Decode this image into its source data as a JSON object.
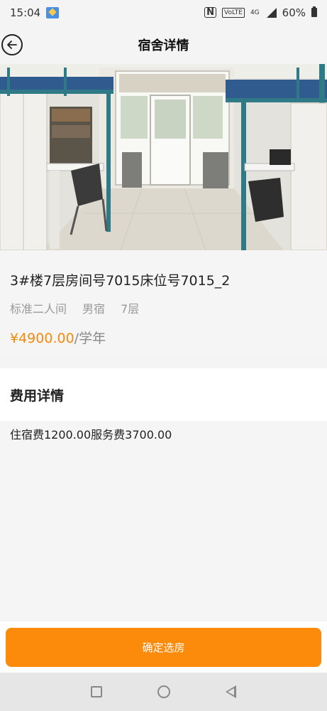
{
  "status_bar": {
    "time": "15:04",
    "nfc": "N",
    "volte": "VoLTE",
    "network": "4G",
    "battery": "60%"
  },
  "header": {
    "title": "宿舍详情",
    "back_icon": "back-arrow-circle-icon"
  },
  "room": {
    "title": "3#楼7层房间号7015床位号7015_2",
    "tags": [
      "标准二人间",
      "男宿",
      "7层"
    ],
    "price": "¥4900.00",
    "price_unit": "/学年"
  },
  "fees": {
    "title": "费用详情",
    "detail": "住宿费1200.00服务费3700.00"
  },
  "actions": {
    "confirm_label": "确定选房"
  },
  "colors": {
    "accent": "#fc8a0b",
    "price": "#f28b0c"
  }
}
